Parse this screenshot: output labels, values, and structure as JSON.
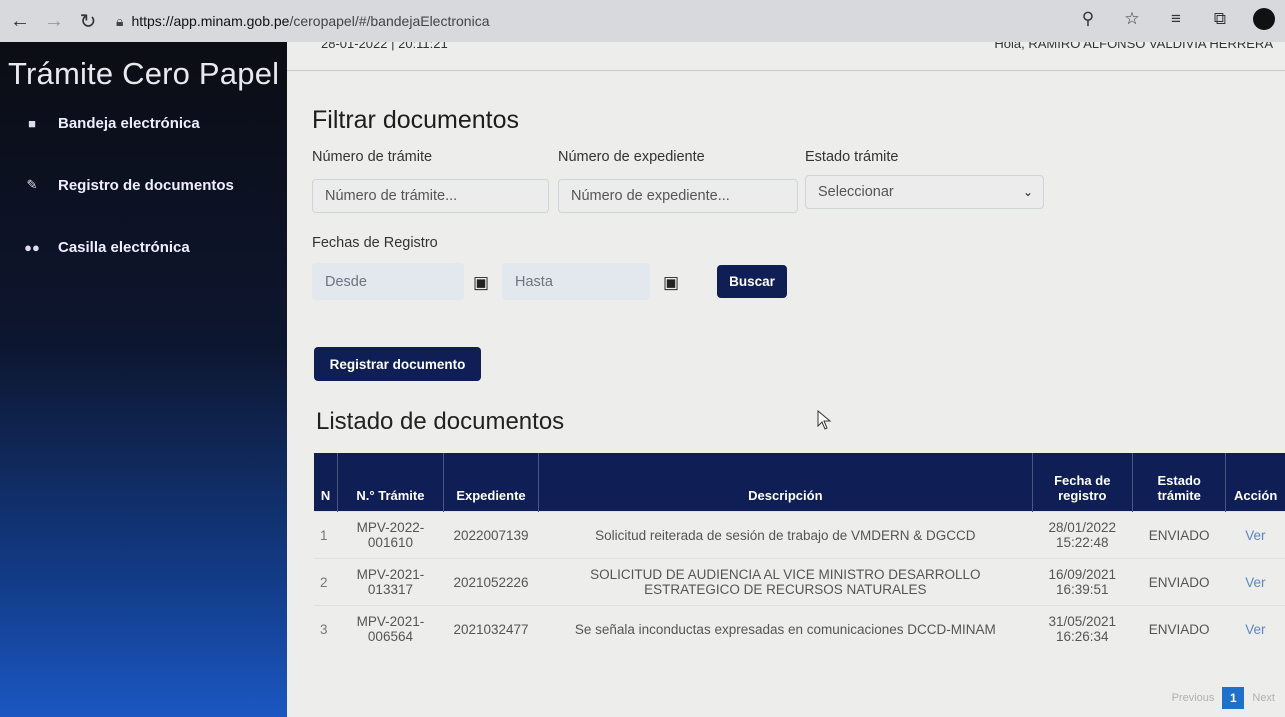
{
  "browser": {
    "url_domain": "https://app.minam.gob.pe",
    "url_path": "/ceropapel/#/bandejaElectronica"
  },
  "sidebar": {
    "brand": "Trámite Cero Papel",
    "items": [
      {
        "label": "Bandeja electrónica",
        "icon": "inbox-icon"
      },
      {
        "label": "Registro de documentos",
        "icon": "edit-icon"
      },
      {
        "label": "Casilla electrónica",
        "icon": "users-icon"
      }
    ]
  },
  "topbar": {
    "left_text": "28-01-2022 | 20:11:21",
    "right_text": "Hola, RAMIRO ALFONSO VALDIVIA HERRERA"
  },
  "filter": {
    "title": "Filtrar documentos",
    "tramite_label": "Número de trámite",
    "tramite_placeholder": "Número de trámite...",
    "expediente_label": "Número de expediente",
    "expediente_placeholder": "Número de expediente...",
    "estado_label": "Estado trámite",
    "estado_value": "Seleccionar",
    "fechas_label": "Fechas de Registro",
    "desde_placeholder": "Desde",
    "hasta_placeholder": "Hasta",
    "buscar_label": "Buscar"
  },
  "registrar_label": "Registrar documento",
  "list": {
    "title": "Listado de documentos",
    "headers": {
      "n": "N",
      "tramite": "N.° Trámite",
      "expediente": "Expediente",
      "descripcion": "Descripción",
      "fecha": "Fecha de registro",
      "estado": "Estado trámite",
      "accion": "Acción"
    },
    "rows": [
      {
        "n": "1",
        "tramite": "MPV-2022-001610",
        "expediente": "2022007139",
        "descripcion": "Solicitud reiterada de sesión de trabajo de VMDERN & DGCCD",
        "fecha": "28/01/2022 15:22:48",
        "estado": "ENVIADO",
        "accion": "Ver"
      },
      {
        "n": "2",
        "tramite": "MPV-2021-013317",
        "expediente": "2021052226",
        "descripcion": "SOLICITUD DE AUDIENCIA AL VICE MINISTRO DESARROLLO ESTRATEGICO DE RECURSOS NATURALES",
        "fecha": "16/09/2021 16:39:51",
        "estado": "ENVIADO",
        "accion": "Ver"
      },
      {
        "n": "3",
        "tramite": "MPV-2021-006564",
        "expediente": "2021032477",
        "descripcion": "Se señala inconductas expresadas en comunicaciones DCCD-MINAM",
        "fecha": "31/05/2021 16:26:34",
        "estado": "ENVIADO",
        "accion": "Ver"
      }
    ]
  },
  "pager": {
    "previous": "Previous",
    "current": "1",
    "next": "Next"
  },
  "colors": {
    "primary": "#0f1f55",
    "link": "#5a86c8",
    "page_active": "#1f70c9"
  }
}
